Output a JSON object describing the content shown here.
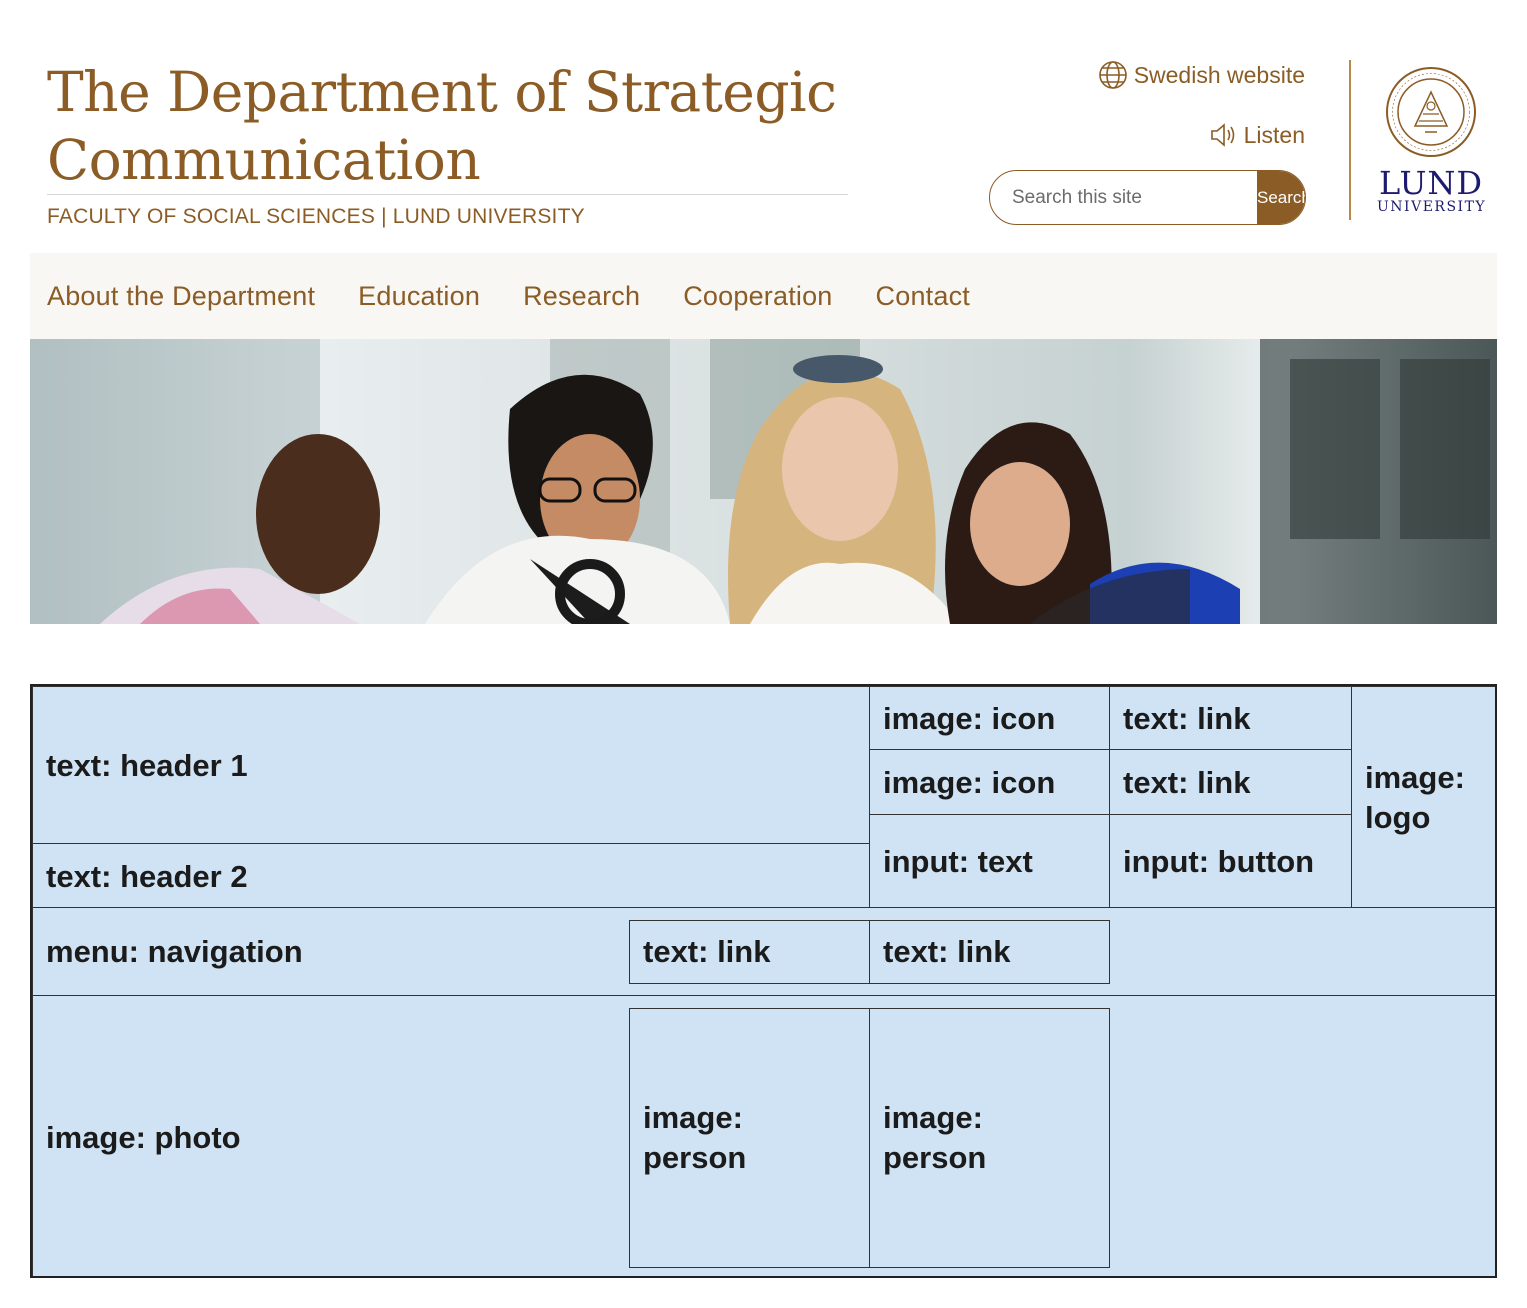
{
  "header": {
    "title": "The Department of Strategic Communication",
    "subtitle": "FACULTY OF SOCIAL SCIENCES | LUND UNIVERSITY"
  },
  "utility": {
    "language_link": "Swedish website",
    "listen_link": "Listen"
  },
  "search": {
    "placeholder": "Search this site",
    "button": "Search"
  },
  "logo": {
    "name": "LUND",
    "sub": "UNIVERSITY"
  },
  "nav": {
    "items": [
      "About the Department",
      "Education",
      "Research",
      "Cooperation",
      "Contact"
    ]
  },
  "hero": {
    "icon": "photo-students"
  },
  "annotations": {
    "header1": "text: header 1",
    "header2": "text: header 2",
    "icon_a": "image: icon",
    "icon_b": "image: icon",
    "link_a": "text: link",
    "link_b": "text: link",
    "input_text": "input: text",
    "input_button": "input: button",
    "logo": "image: logo",
    "menu": "menu: navigation",
    "nav_link_a": "text: link",
    "nav_link_b": "text: link",
    "photo": "image: photo",
    "person_a": "image: person",
    "person_b": "image: person"
  },
  "colors": {
    "brand": "#8b5c25",
    "nav_bg": "#f8f7f4",
    "logo_blue": "#1d1b6e",
    "overlay_tint": "#b0d0ec"
  }
}
